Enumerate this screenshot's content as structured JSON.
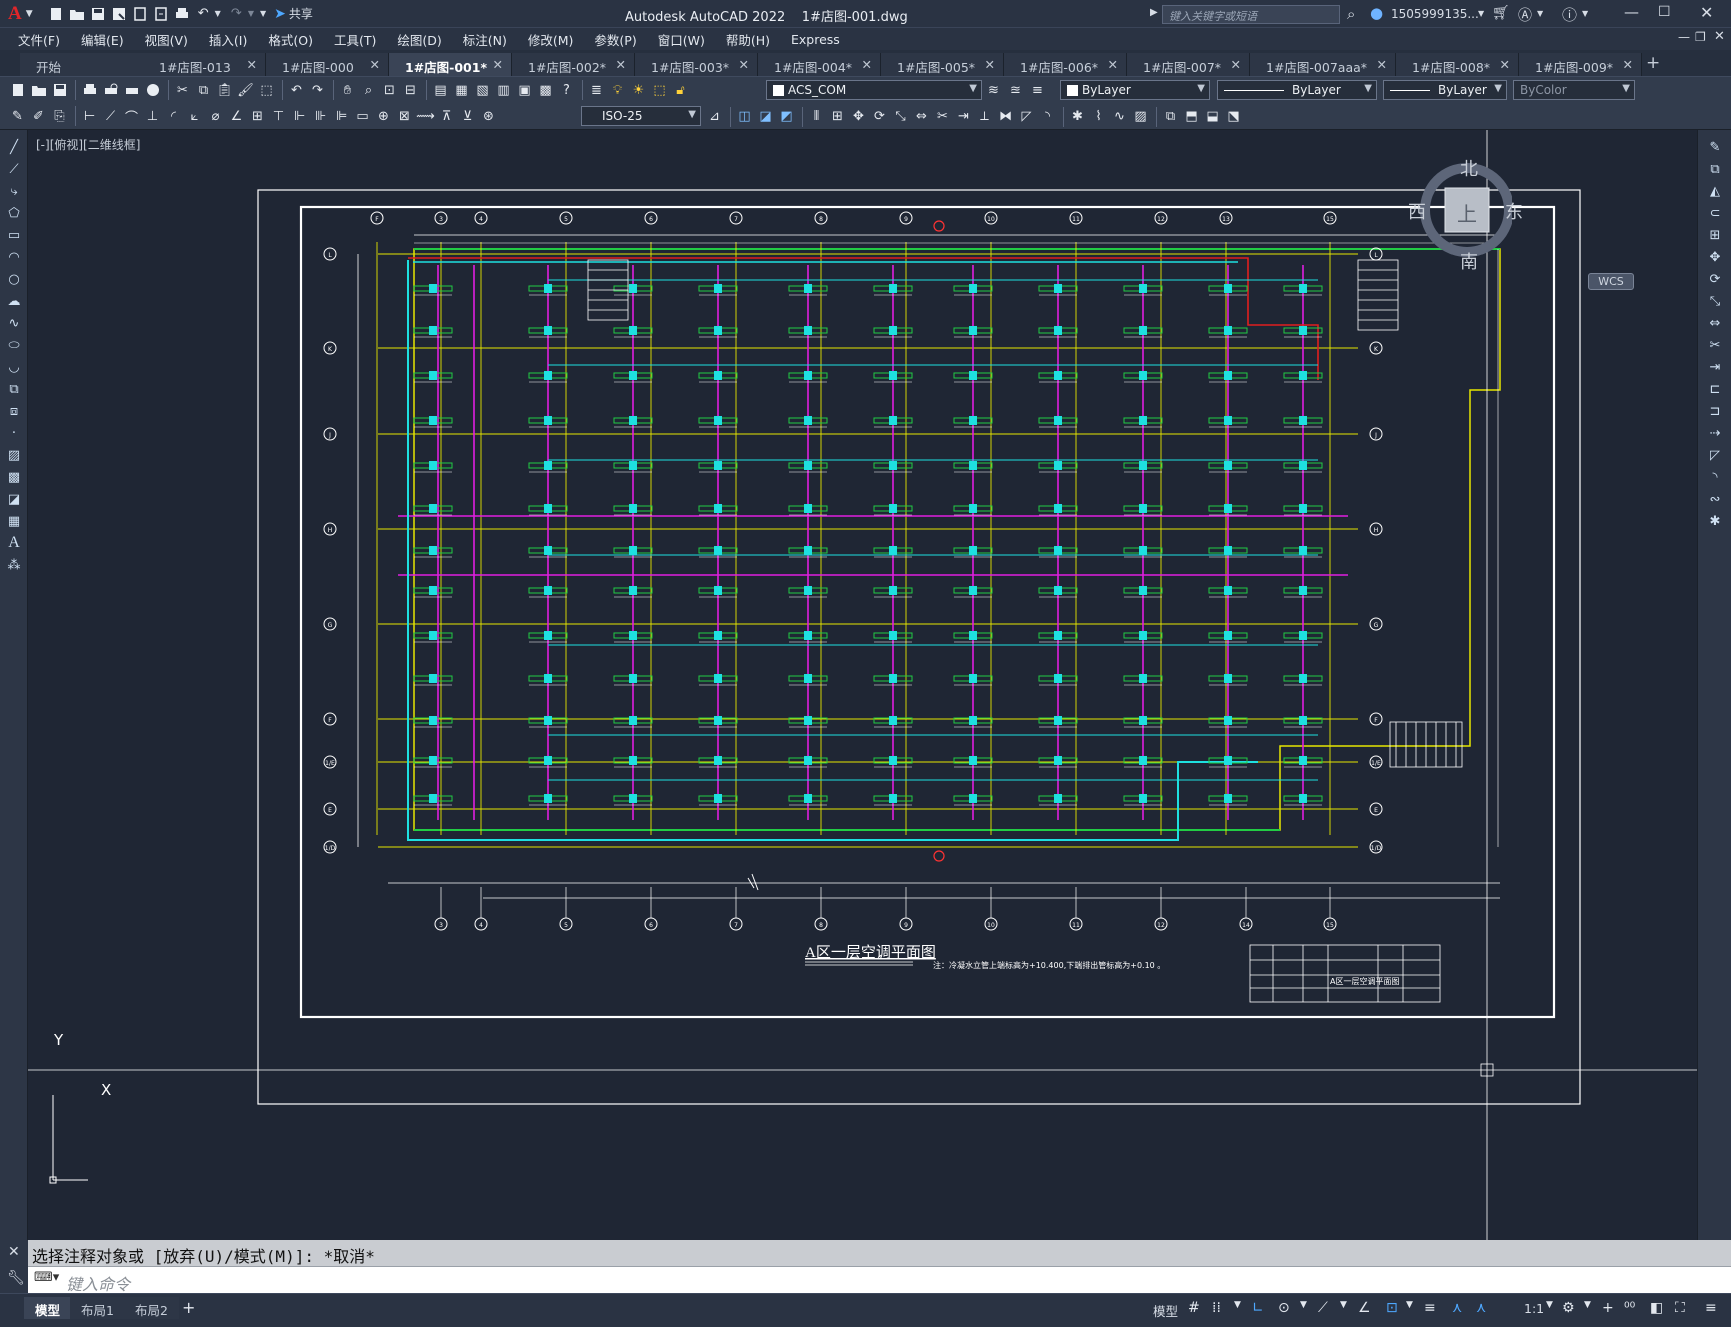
{
  "title": {
    "app": "Autodesk AutoCAD 2022",
    "file": "1#店图-001.dwg",
    "search_placeholder": "键入关键字或短语",
    "user": "1505999135...",
    "share": "共享"
  },
  "menus": [
    "文件(F)",
    "编辑(E)",
    "视图(V)",
    "插入(I)",
    "格式(O)",
    "工具(T)",
    "绘图(D)",
    "标注(N)",
    "修改(M)",
    "参数(P)",
    "窗口(W)",
    "帮助(H)",
    "Express"
  ],
  "tabs": [
    {
      "label": "开始"
    },
    {
      "label": "1#店图-013"
    },
    {
      "label": "1#店图-000"
    },
    {
      "label": "1#店图-001*"
    },
    {
      "label": "1#店图-002*"
    },
    {
      "label": "1#店图-003*"
    },
    {
      "label": "1#店图-004*"
    },
    {
      "label": "1#店图-005*"
    },
    {
      "label": "1#店图-006*"
    },
    {
      "label": "1#店图-007*"
    },
    {
      "label": "1#店图-007aaa*"
    },
    {
      "label": "1#店图-008*"
    },
    {
      "label": "1#店图-009*"
    }
  ],
  "toolbar": {
    "layer": "ACS_COM",
    "color": "ByLayer",
    "linetype": "ByLayer",
    "lineweight": "ByLayer",
    "plotstyle": "ByColor",
    "dimstyle": "ISO-25"
  },
  "viewport": {
    "label": "[-][俯视][二维线框]",
    "compass": {
      "n": "北",
      "s": "南",
      "e": "东",
      "w": "西",
      "center": "上"
    },
    "wcs": "WCS",
    "ucs_y": "Y",
    "ucs_x": "X"
  },
  "drawing": {
    "title": "A区一层空调平面图",
    "note": "注：冷凝水立管上端标高为+10.400,下端排出管标高为+0.10 。",
    "title_block_name": "A区一层空调平面图",
    "grid_top": [
      "F",
      "3",
      "4",
      "5",
      "6",
      "7",
      "8",
      "9",
      "10",
      "11",
      "12",
      "13",
      "15"
    ],
    "grid_bottom": [
      "3",
      "4",
      "5",
      "6",
      "7",
      "8",
      "9",
      "10",
      "11",
      "12",
      "14",
      "15"
    ],
    "grid_left": [
      "L",
      "K",
      "J",
      "H",
      "G",
      "F",
      "1/E",
      "E",
      "1/D"
    ]
  },
  "command": {
    "history": "选择注释对象或 [放弃(U)/模式(M)]: *取消*",
    "placeholder": "键入命令"
  },
  "layouts": [
    "模型",
    "布局1",
    "布局2"
  ],
  "status": {
    "space": "模型",
    "scale": "1:1"
  },
  "colors": {
    "background": "#1f2634",
    "frame": "#ffffff",
    "grid_line": "#e6e600",
    "duct_magenta": "#e01ee0",
    "duct_cyan": "#1ee0e0",
    "duct_red": "#e01e1e",
    "unit_green": "#22cc44"
  }
}
